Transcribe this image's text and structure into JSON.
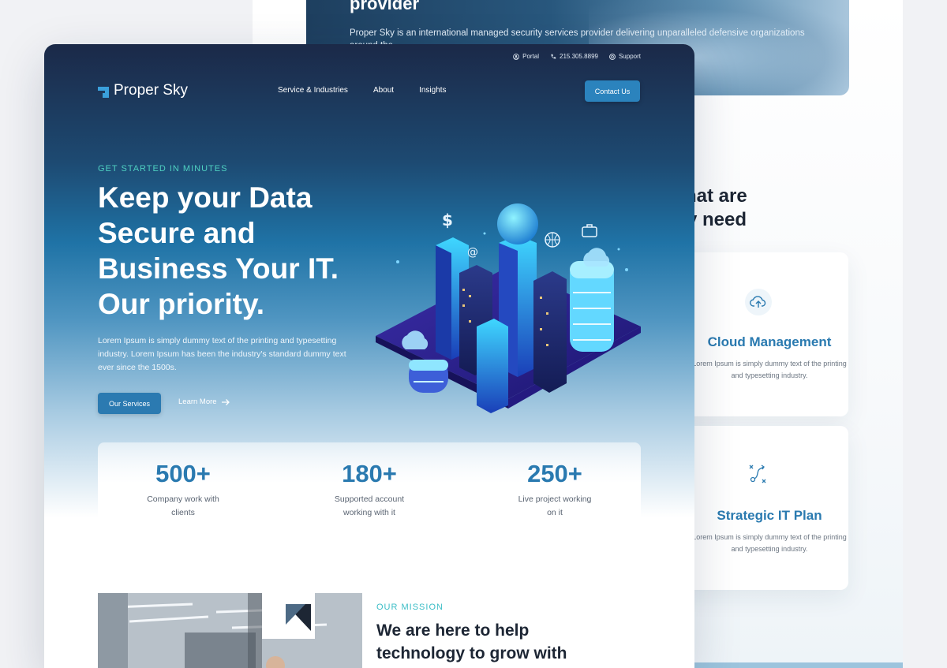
{
  "colors": {
    "accent": "#2b83bd",
    "teal": "#4fd1c1",
    "stat_number": "#2a7ab0",
    "dark_text": "#1d2634"
  },
  "background_page": {
    "hero_title": "provider",
    "hero_text": "Proper Sky is an international managed security services provider delivering unparalleled defensive organizations around the",
    "section_heading_line1": "hat are",
    "section_heading_line2": "y need",
    "cards": [
      {
        "icon": "cloud-upload-icon",
        "title": "Cloud Management",
        "text": "Lorem Ipsum is simply dummy text of the printing and typesetting industry."
      },
      {
        "icon": "strategy-path-icon",
        "title": "Strategic IT Plan",
        "text": "Lorem Ipsum is simply dummy text of the printing and typesetting industry."
      }
    ]
  },
  "topbar": {
    "portal": "Portal",
    "phone": "215.305.8899",
    "support": "Support"
  },
  "brand": {
    "name": "Proper Sky"
  },
  "nav": {
    "items": [
      "Service & Industries",
      "About",
      "Insights"
    ],
    "contact_label": "Contact Us"
  },
  "hero": {
    "eyebrow": "GET STARTED IN MINUTES",
    "headline": "Keep your Data Secure and Business Your IT. Our priority.",
    "lead": "Lorem Ipsum is simply dummy text of the printing and typesetting industry. Lorem Ipsum has been the industry's standard dummy text ever since the 1500s.",
    "primary_cta": "Our Services",
    "secondary_cta": "Learn More"
  },
  "stats": [
    {
      "value": "500+",
      "label_line1": "Company work with",
      "label_line2": "clients"
    },
    {
      "value": "180+",
      "label_line1": "Supported account",
      "label_line2": "working with it"
    },
    {
      "value": "250+",
      "label_line1": "Live project working",
      "label_line2": "on it"
    }
  ],
  "mission": {
    "eyebrow": "OUR MISSION",
    "title": "We are here to help technology to grow with"
  }
}
